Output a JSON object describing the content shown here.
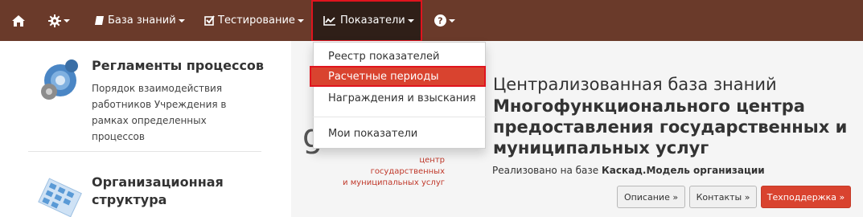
{
  "navbar": {
    "home_icon": "home-icon",
    "settings_icon": "gear-icon",
    "knowledge_base": "База знаний",
    "testing": "Тестирование",
    "indicators": "Показатели",
    "help_icon": "question-circle-icon"
  },
  "dropdown": {
    "items": [
      "Реестр показателей",
      "Расчетные периоды",
      "Награждения и взыскания",
      "Мои показатели"
    ],
    "active_index": 1
  },
  "left": {
    "block1": {
      "title": "Регламенты процессов",
      "text_lines": [
        "Порядок взаимодействия",
        "работников Учреждения в",
        "рамках определенных",
        "процессов"
      ]
    },
    "block2": {
      "title_lines": [
        "Организационная",
        "структура"
      ]
    }
  },
  "banner": {
    "logo_sub": [
      "центр",
      "государственных",
      "и муниципальных услуг"
    ],
    "hero_line1": "Централизованная база знаний",
    "hero_bold": [
      "Многофункционального центра",
      "предоставления государственных и",
      "муниципальных услуг"
    ],
    "base_prefix": "Реализовано на базе ",
    "base_name": "Каскад.Модель организации",
    "buttons": [
      "Описание »",
      "Контакты »",
      "Техподдержка »"
    ]
  },
  "colors": {
    "navbar": "#6a3a2a",
    "active_tab": "#2f1f18",
    "highlight_red": "#e0141e",
    "accent": "#d9432f"
  }
}
